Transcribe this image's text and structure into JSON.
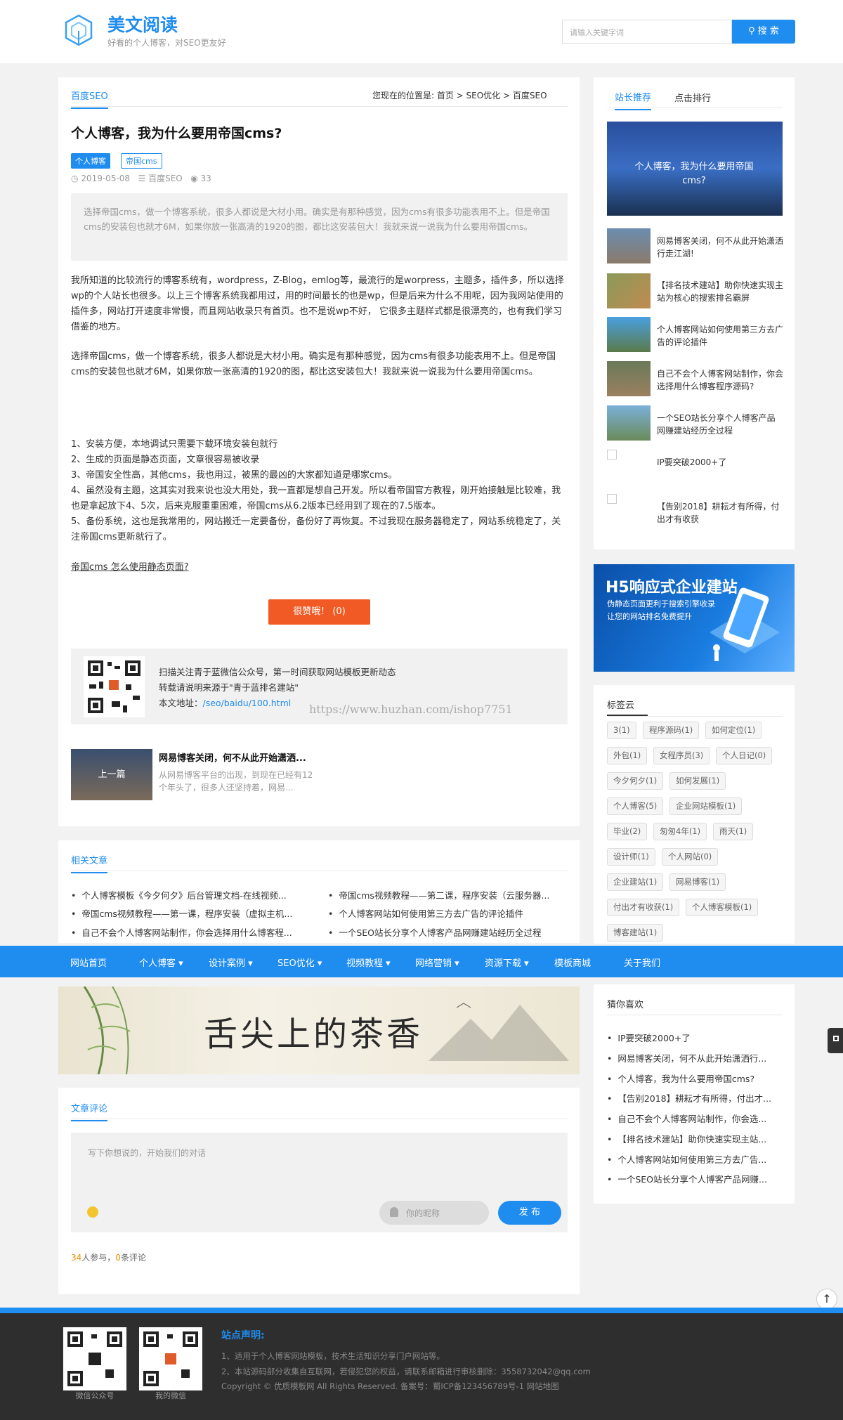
{
  "header": {
    "site_name": "美文阅读",
    "tagline": "好看的个人博客，对SEO更友好",
    "search_placeholder": "请输入关键字词",
    "search_button": "搜 索"
  },
  "article": {
    "category_title": "百度SEO",
    "breadcrumb": "您现在的位置是: 首页 > SEO优化 > 百度SEO",
    "title": "个人博客，我为什么要用帝国cms?",
    "tags": [
      "个人博客",
      "帝国cms"
    ],
    "date": "2019-05-08",
    "category": "百度SEO",
    "views": "33",
    "quote": "选择帝国cms，做一个博客系统，很多人都说是大材小用。确实是有那种感觉，因为cms有很多功能表用不上。但是帝国cms的安装包也就才6M，如果你放一张高清的1920的图，都比这安装包大！我就来说一说我为什么要用帝国cms。",
    "p1": "我所知道的比较流行的博客系统有，wordpress，Z-Blog，emlog等，最流行的是worpress，主题多，插件多，所以选择wp的个人站长也很多。以上三个博客系统我都用过，用的时间最长的也是wp，但是后来为什么不用呢，因为我网站使用的插件多，网站打开速度非常慢，而且网站收录只有首页。也不是说wp不好， 它很多主题样式都是很漂亮的，也有我们学习借鉴的地方。",
    "p2": "选择帝国cms，做一个博客系统，很多人都说是大材小用。确实是有那种感觉，因为cms有很多功能表用不上。但是帝国cms的安装包也就才6M，如果你放一张高清的1920的图，都比这安装包大！我就来说一说我为什么要用帝国cms。",
    "list": [
      "1、安装方便，本地调试只需要下载环境安装包就行",
      "2、生成的页面是静态页面，文章很容易被收录",
      "3、帝国安全性高，其他cms，我也用过，被黑的最凶的大家都知道是哪家cms。",
      "4、虽然没有主题，这其实对我来说也没大用处，我一直都是想自己开发。所以看帝国官方教程，刚开始接触是比较难，我也是拿起放下4、5次，后来克服重重困难，帝国cms从6.2版本已经用到了现在的7.5版本。",
      "5、备份系统，这也是我常用的，网站搬迁一定要备份，备份好了再恢复。不过我现在服务器稳定了，网站系统稳定了，关注帝国cms更新就行了。"
    ],
    "link_text": "帝国cms 怎么使用静态页面?",
    "like_button": "很赞哦！ (0)",
    "share_lines": [
      "扫描关注青于蓝微信公众号，第一时间获取网站模板更新动态",
      "转载请说明来源于\"青于蓝排名建站\""
    ],
    "share_url_label": "本文地址：",
    "share_url": "/seo/baidu/100.html",
    "watermark": "https://www.huzhan.com/ishop7751",
    "prev_label": "上一篇",
    "prev_title": "网易博客关闭，何不从此开始潇洒...",
    "prev_desc": "从网易博客平台的出现，到现在已经有12个年头了，很多人还坚持着，网易..."
  },
  "related": {
    "title": "相关文章",
    "items": [
      "个人博客模板《今夕何夕》后台管理文档-在线视频...",
      "帝国cms视频教程——第二课，程序安装（云服务器...",
      "帝国cms视频教程——第一课，程序安装（虚拟主机...",
      "个人博客网站如何使用第三方去广告的评论插件",
      "自己不会个人博客网站制作，你会选择用什么博客程...",
      "一个SEO站长分享个人博客产品网赚建站经历全过程"
    ]
  },
  "nav": [
    "网站首页",
    "个人博客 ▾",
    "设计案例 ▾",
    "SEO优化 ▾",
    "视频教程 ▾",
    "网络营销 ▾",
    "资源下载 ▾",
    "模板商城",
    "关于我们"
  ],
  "banner": {
    "text": "舌尖上的茶香"
  },
  "comments": {
    "title": "文章评论",
    "placeholder": "写下你想说的，开始我们的对话",
    "nick_placeholder": "你的昵称",
    "post_button": "发 布",
    "participants": "34",
    "participants_label": "人参与，",
    "count": "0",
    "count_label": "条评论"
  },
  "sidebar": {
    "tabs": [
      "站长推荐",
      "点击排行"
    ],
    "featured": "个人博客，我为什么要用帝国cms?",
    "items": [
      "网易博客关闭，何不从此开始潇洒行走江湖!",
      "【排名技术建站】助你快速实现主站为核心的搜索排名霸屏",
      "个人博客网站如何使用第三方去广告的评论插件",
      "自己不会个人博客网站制作，你会选择用什么博客程序源码?",
      "一个SEO站长分享个人博客产品网赚建站经历全过程",
      "IP要突破2000+了",
      "【告别2018】耕耘才有所得，付出才有收获"
    ],
    "ad_title": "H5响应式企业建站",
    "ad_sub": [
      "伪静态页面更利于搜索引擎收录",
      "让您的网站排名免费提升"
    ],
    "tag_cloud_title": "标签云",
    "tags": [
      "3(1)",
      "程序源码(1)",
      "如何定位(1)",
      "外包(1)",
      "女程序员(3)",
      "个人日记(0)",
      "今夕何夕(1)",
      "如何发展(1)",
      "个人博客(5)",
      "企业网站模板(1)",
      "毕业(2)",
      "匆匆4年(1)",
      "雨天(1)",
      "设计师(1)",
      "个人网站(0)",
      "企业建站(1)",
      "网易博客(1)",
      "付出才有收获(1)",
      "个人博客模板(1)",
      "博客建站(1)"
    ],
    "guess_title": "猜你喜欢",
    "guess": [
      "IP要突破2000+了",
      "网易博客关闭，何不从此开始潇洒行...",
      "个人博客，我为什么要用帝国cms?",
      "【告别2018】耕耘才有所得，付出才...",
      "自己不会个人博客网站制作，你会选...",
      "【排名技术建站】助你快速实现主站...",
      "个人博客网站如何使用第三方去广告...",
      "一个SEO站长分享个人博客产品网赚..."
    ]
  },
  "footer": {
    "qr_labels": [
      "微信公众号",
      "我的微信"
    ],
    "heading": "站点声明:",
    "lines": [
      "1、适用于个人博客网站模板，技术生活知识分享门户网站等。",
      "2、本站源码部分收集自互联网，若侵犯您的权益，请联系邮箱进行审核删除：3558732042@qq.com",
      "Copyright © 优质模板网 All Rights Reserved. 备案号：蜀ICP备123456789号-1 网站地图"
    ]
  },
  "colors": {
    "accent": "#1f8cf0",
    "like": "#f15a24",
    "footer_bg": "#2e2e2e"
  }
}
